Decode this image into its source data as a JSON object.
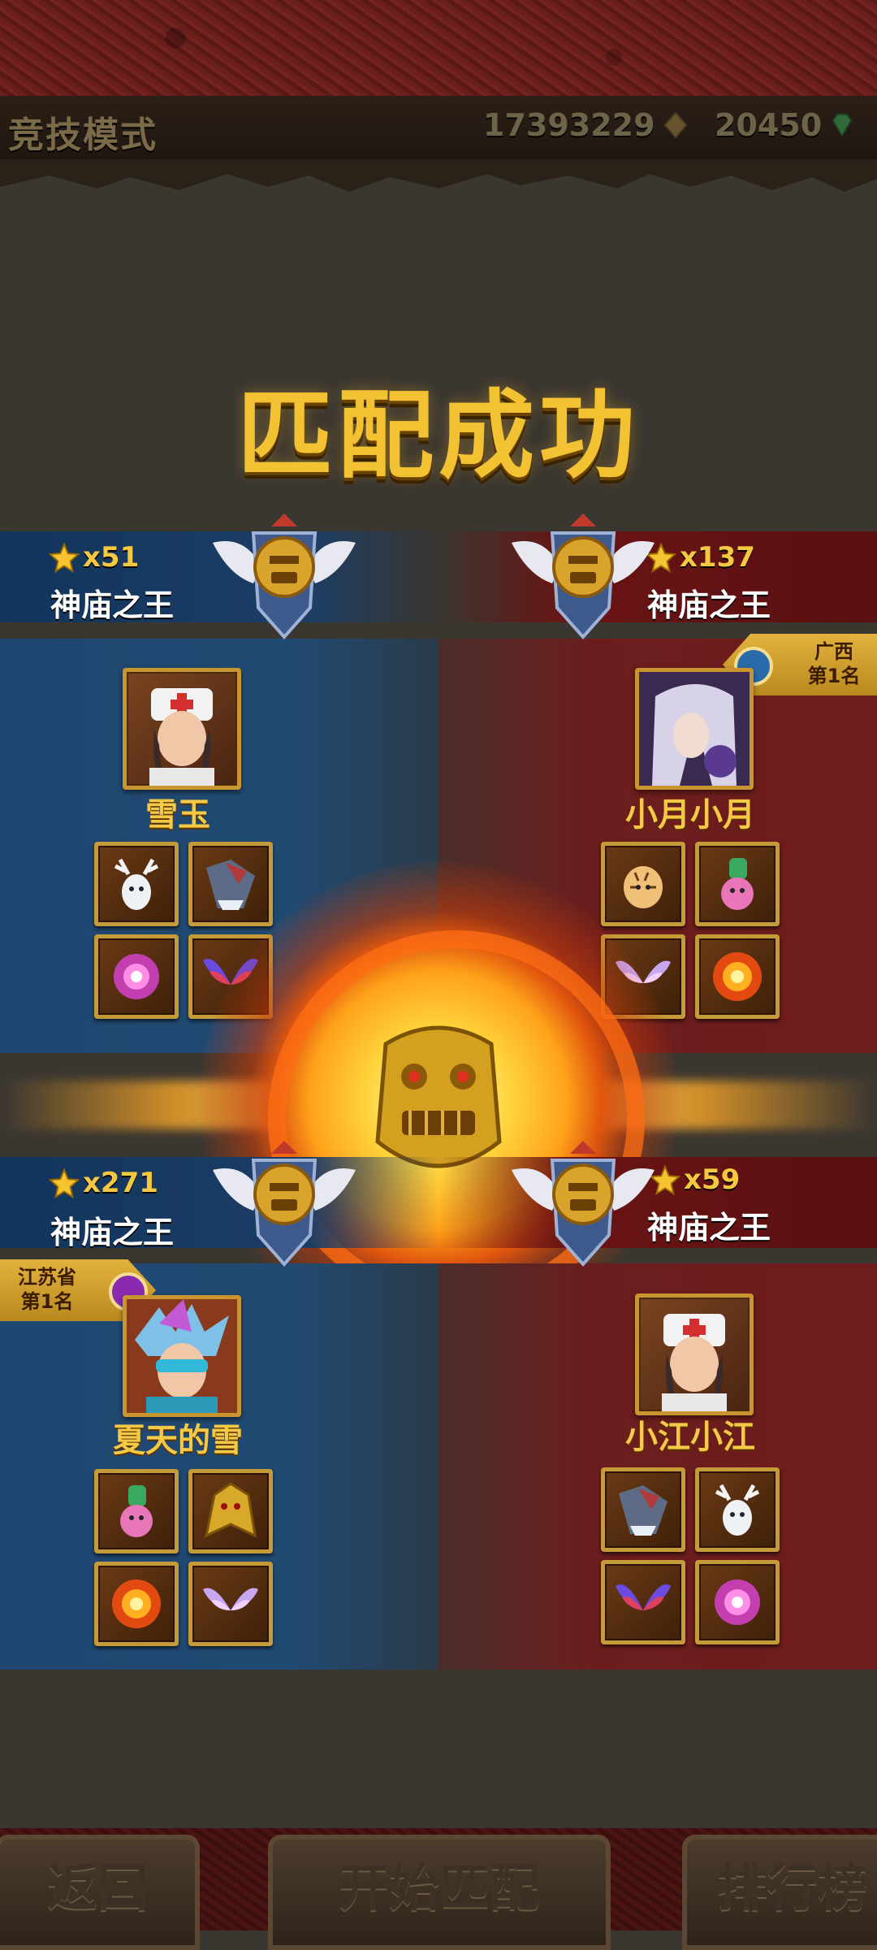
{
  "header": {
    "mode_title": "竞技模式",
    "gold": "17393229",
    "gems": "20450"
  },
  "headline": "匹配成功",
  "players": [
    {
      "side": "left",
      "stars": "x51",
      "rank": "神庙之王",
      "name": "雪玉",
      "region": null,
      "items": [
        "deer-pet-icon",
        "wolf-pet-icon",
        "pink-orb-icon",
        "purple-wings-icon"
      ]
    },
    {
      "side": "right",
      "stars": "x137",
      "rank": "神庙之王",
      "name": "小月小月",
      "region": {
        "line1": "广西",
        "line2": "第1名"
      },
      "items": [
        "tiger-pet-icon",
        "pink-creature-icon",
        "pink-wings-icon",
        "fire-orb-icon"
      ]
    },
    {
      "side": "left",
      "stars": "x271",
      "rank": "神庙之王",
      "name": "夏天的雪",
      "region": {
        "line1": "江苏省",
        "line2": "第1名"
      },
      "items": [
        "pink-creature-icon",
        "golden-dragon-icon",
        "fire-orb-icon",
        "pink-wings-icon"
      ]
    },
    {
      "side": "right",
      "stars": "x59",
      "rank": "神庙之王",
      "name": "小江小江",
      "region": null,
      "items": [
        "wolf-pet-icon",
        "deer-pet-icon",
        "purple-wings-icon",
        "pink-orb-icon"
      ]
    }
  ],
  "buttons": {
    "back": "返回",
    "start": "开始匹配",
    "ranking": "排行榜"
  },
  "colors": {
    "gold_text": "#f3c946",
    "team_blue": "#214a73",
    "team_red": "#6b1d1d"
  }
}
